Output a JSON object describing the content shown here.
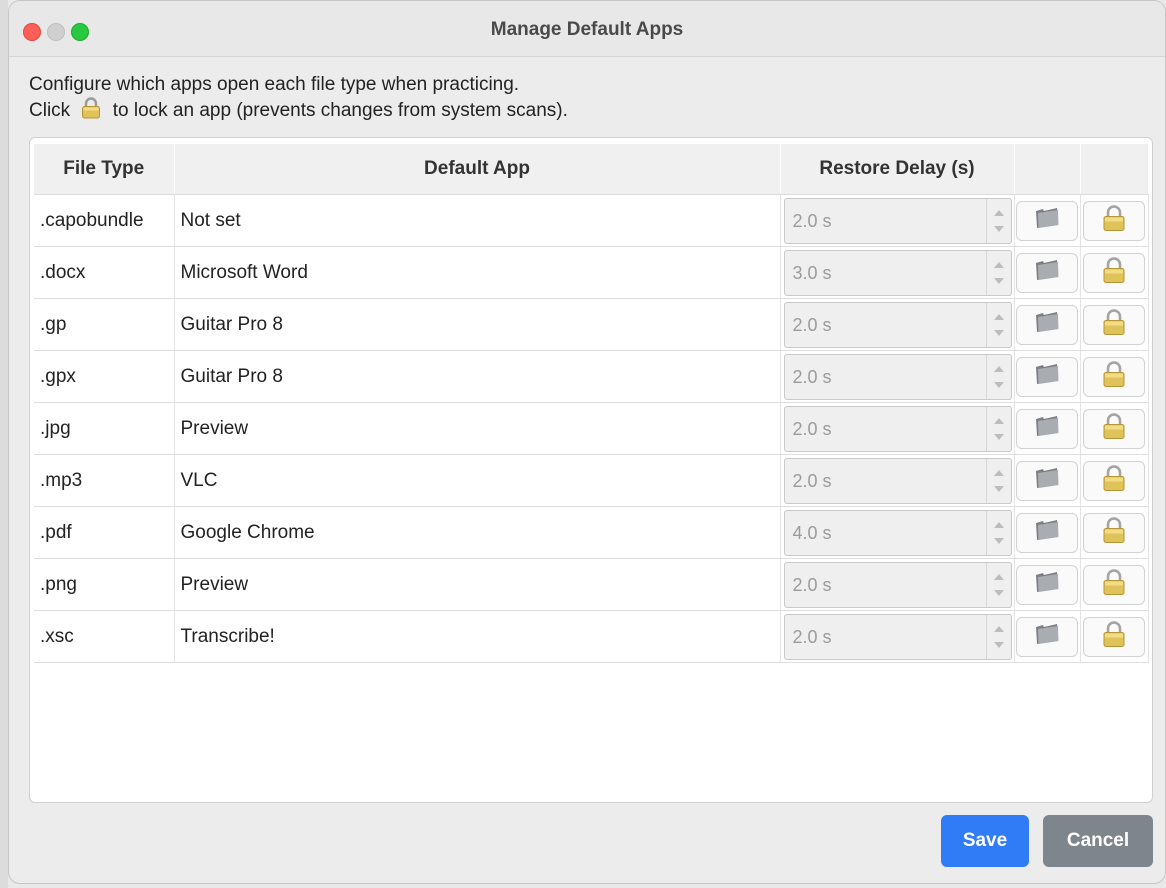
{
  "window": {
    "title": "Manage Default Apps"
  },
  "intro": {
    "line1": "Configure which apps open each file type when practicing.",
    "line2_before": "Click",
    "line2_after": "to lock an app (prevents changes from system scans).",
    "line2_icon": "lock-icon"
  },
  "table": {
    "columns": [
      "File Type",
      "Default App",
      "Restore Delay (s)",
      "",
      ""
    ],
    "rows": [
      {
        "file_type": ".capobundle",
        "app": "Not set",
        "delay": "2.0 s"
      },
      {
        "file_type": ".docx",
        "app": "Microsoft Word",
        "delay": "3.0 s"
      },
      {
        "file_type": ".gp",
        "app": "Guitar Pro 8",
        "delay": "2.0 s"
      },
      {
        "file_type": ".gpx",
        "app": "Guitar Pro 8",
        "delay": "2.0 s"
      },
      {
        "file_type": ".jpg",
        "app": "Preview",
        "delay": "2.0 s"
      },
      {
        "file_type": ".mp3",
        "app": "VLC",
        "delay": "2.0 s"
      },
      {
        "file_type": ".pdf",
        "app": "Google Chrome",
        "delay": "4.0 s"
      },
      {
        "file_type": ".png",
        "app": "Preview",
        "delay": "2.0 s"
      },
      {
        "file_type": ".xsc",
        "app": "Transcribe!",
        "delay": "2.0 s"
      }
    ],
    "row_icons": {
      "browse": "folder-icon",
      "lock": "lock-icon"
    }
  },
  "buttons": {
    "save": "Save",
    "cancel": "Cancel"
  },
  "colors": {
    "save_bg": "#2f7cf6",
    "cancel_bg": "#7f858c",
    "close": "#ff5f57",
    "zoom": "#28c840"
  }
}
